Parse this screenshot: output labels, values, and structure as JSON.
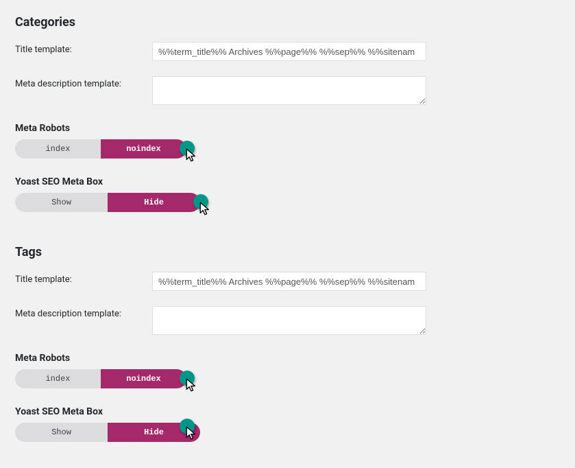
{
  "sections": [
    {
      "heading": "Categories",
      "title_template_label": "Title template:",
      "title_template_value": "%%term_title%% Archives %%page%% %%sep%% %%sitenam",
      "meta_desc_label": "Meta description template:",
      "meta_desc_value": "",
      "meta_robots_heading": "Meta Robots",
      "meta_robots_left": "index",
      "meta_robots_right": "noindex",
      "metabox_heading": "Yoast SEO Meta Box",
      "metabox_left": "Show",
      "metabox_right": "Hide"
    },
    {
      "heading": "Tags",
      "title_template_label": "Title template:",
      "title_template_value": "%%term_title%% Archives %%page%% %%sep%% %%sitenam",
      "meta_desc_label": "Meta description template:",
      "meta_desc_value": "",
      "meta_robots_heading": "Meta Robots",
      "meta_robots_left": "index",
      "meta_robots_right": "noindex",
      "metabox_heading": "Yoast SEO Meta Box",
      "metabox_left": "Show",
      "metabox_right": "Hide"
    }
  ]
}
